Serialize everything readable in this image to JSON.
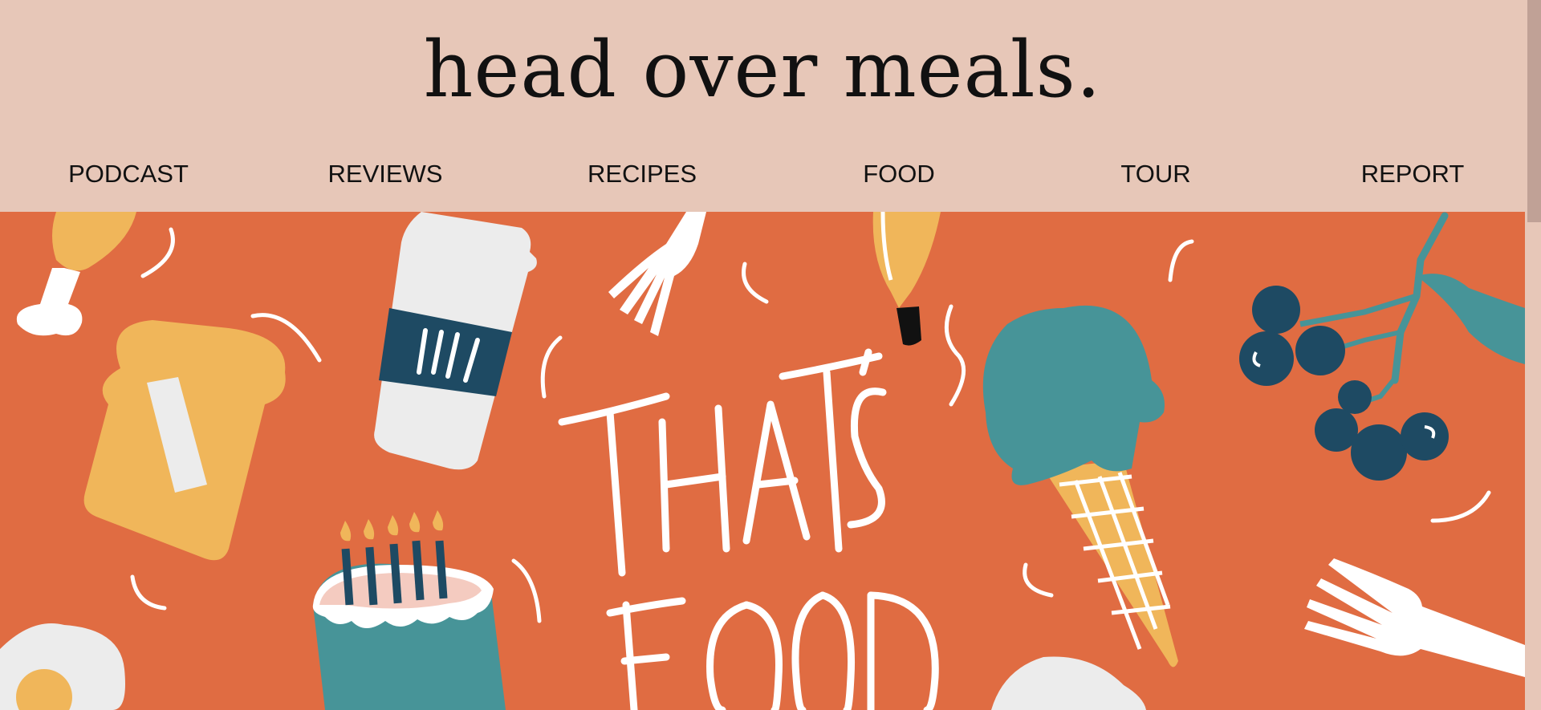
{
  "site": {
    "title": "head over meals."
  },
  "nav": {
    "items": [
      "PODCAST",
      "REVIEWS",
      "RECIPES",
      "FOOD",
      "TOUR",
      "REPORT"
    ]
  },
  "hero": {
    "lettering": "THAT'S FOOD",
    "background_color": "#e06c42"
  },
  "colors": {
    "header_bg": "#e7c7b8",
    "hero_bg": "#e06c42",
    "mustard": "#f0b65a",
    "teal": "#479498",
    "navy": "#1e4a63",
    "cream": "#ececec"
  }
}
